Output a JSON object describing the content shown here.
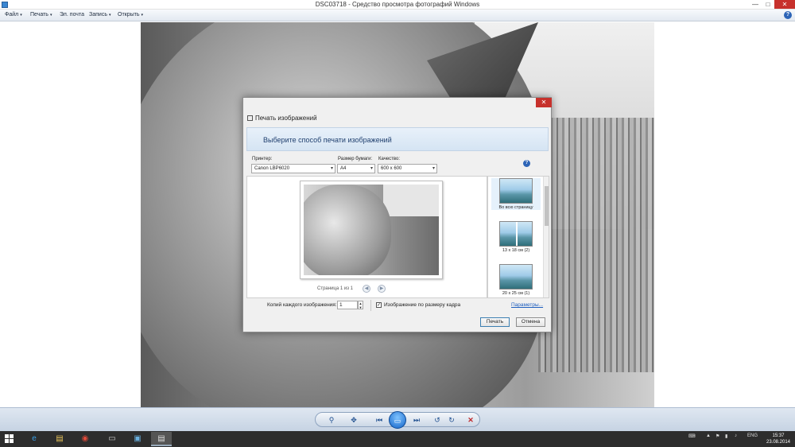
{
  "window": {
    "title": "DSC03718 - Средство просмотра фотографий Windows",
    "min_label": "—",
    "max_label": "□",
    "close_label": "✕"
  },
  "menu": {
    "items": [
      {
        "label": "Файл"
      },
      {
        "label": "Печать"
      },
      {
        "label": "Эл. почта"
      },
      {
        "label": "Запись"
      },
      {
        "label": "Открыть"
      }
    ],
    "dropdown_glyph": "▾",
    "help_glyph": "?"
  },
  "dialog": {
    "title": "Печать изображений",
    "close_label": "✕",
    "banner": "Выберите способ печати изображений",
    "printer": {
      "label": "Принтер:",
      "value": "Canon LBP6020"
    },
    "paper": {
      "label": "Размер бумаги:",
      "value": "A4"
    },
    "quality": {
      "label": "Качество:",
      "value": "600 x 600"
    },
    "help_glyph": "?",
    "page_nav": "Страница 1 из 1",
    "prev_glyph": "◀",
    "next_glyph": "▶",
    "layouts": [
      {
        "caption": "Во всю страницу",
        "selected": true
      },
      {
        "caption": "13 x 18 см (2)",
        "selected": false
      },
      {
        "caption": "20 x 25 см (1)",
        "selected": false
      }
    ],
    "copies": {
      "label": "Копий каждого изображения:",
      "value": "1"
    },
    "fit": {
      "label": "Изображение по размеру кадра",
      "checked": true,
      "check_glyph": "✓"
    },
    "params_link": "Параметры...",
    "print_button": "Печать",
    "cancel_button": "Отмена"
  },
  "controls": {
    "zoom": "⚲",
    "fit_glyph": "✥",
    "prev": "⏮",
    "slideshow": "▭",
    "next": "⏭",
    "rotate_left": "↺",
    "rotate_right": "↻",
    "delete": "✕"
  },
  "taskbar": {
    "lang": "ENG",
    "time": "15:37",
    "date": "23.08.2014"
  },
  "colors": {
    "accent": "#2d64b7",
    "close": "#c7312c",
    "taskbar": "#2d2d2d"
  }
}
